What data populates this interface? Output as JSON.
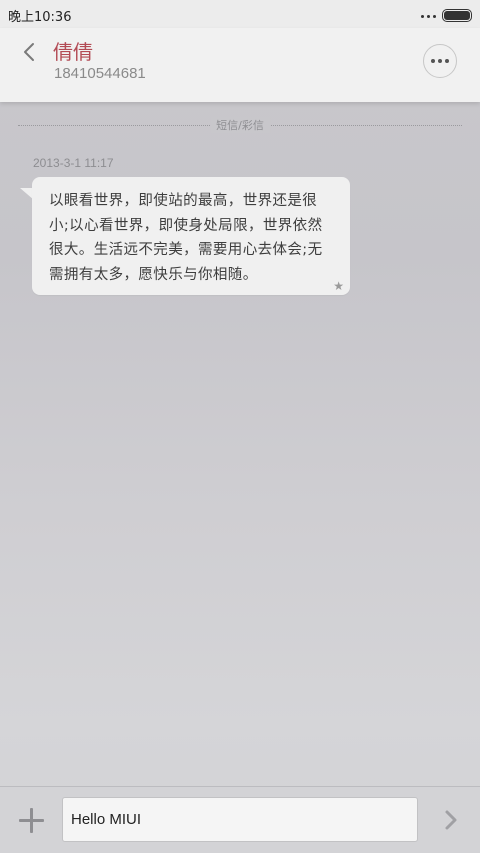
{
  "status_bar": {
    "time": "晚上10:36"
  },
  "header": {
    "contact_name": "倩倩",
    "contact_number": "18410544681"
  },
  "thread": {
    "type_label": "短信/彩信",
    "messages": [
      {
        "timestamp": "2013-3-1 11:17",
        "text": "以眼看世界，即使站的最高，世界还是很小;以心看世界，即使身处局限，世界依然很大。生活远不完美，需要用心去体会;无需拥有太多，愿快乐与你相随。",
        "starred": true,
        "star_glyph": "★"
      }
    ]
  },
  "composer": {
    "input_value": "Hello MIUI"
  },
  "colors": {
    "contact_name": "#b34b55",
    "bubble": "#f0f0f0",
    "background": "#c9c8cc"
  },
  "icons": {
    "back": "chevron-left-icon",
    "more": "more-dots-icon",
    "add": "plus-icon",
    "send": "chevron-right-icon",
    "star": "star-icon",
    "battery": "battery-icon"
  }
}
